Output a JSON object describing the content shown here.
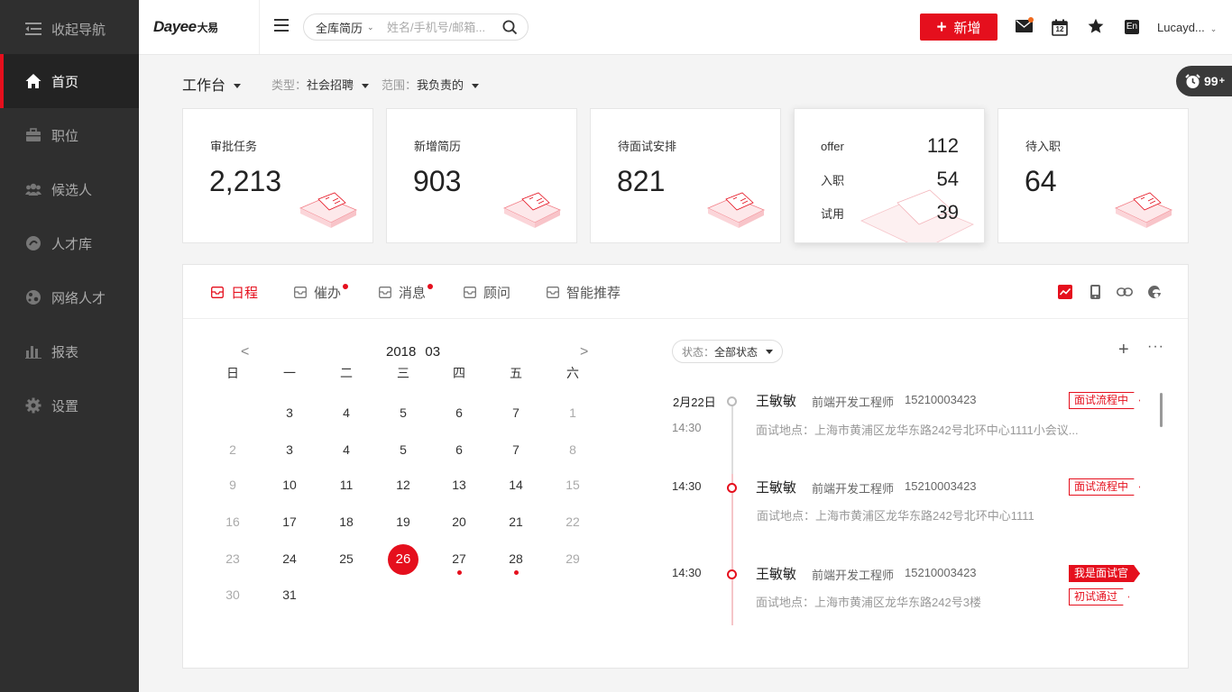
{
  "sidebar": {
    "collapse": "收起导航",
    "items": [
      {
        "label": "首页",
        "icon": "home-icon",
        "active": true
      },
      {
        "label": "职位",
        "icon": "briefcase-icon"
      },
      {
        "label": "候选人",
        "icon": "people-icon"
      },
      {
        "label": "人才库",
        "icon": "talent-pool-icon"
      },
      {
        "label": "网络人才",
        "icon": "network-icon"
      },
      {
        "label": "报表",
        "icon": "bar-chart-icon"
      },
      {
        "label": "设置",
        "icon": "gear-icon"
      }
    ]
  },
  "header": {
    "logo": "Dayee",
    "logo_cn": "大易",
    "search_scope": "全库简历",
    "search_placeholder": "姓名/手机号/邮箱...",
    "add_label": "新增",
    "calendar_day": "12",
    "lang": "En",
    "user": "Lucayd..."
  },
  "float_badge": {
    "count": "99",
    "suffix": "+"
  },
  "workbench": {
    "title": "工作台",
    "type_label": "类型：",
    "type_value": "社会招聘",
    "range_label": "范围：",
    "range_value": "我负责的"
  },
  "cards": [
    {
      "label": "审批任务",
      "value": "2,213"
    },
    {
      "label": "新增简历",
      "value": "903"
    },
    {
      "label": "待面试安排",
      "value": "821"
    },
    {
      "label": "待入职",
      "value": "64"
    }
  ],
  "multi_card": {
    "rows": [
      {
        "label": "offer",
        "value": "112"
      },
      {
        "label": "入职",
        "value": "54"
      },
      {
        "label": "试用",
        "value": "39"
      }
    ]
  },
  "tabs": [
    {
      "label": "日程",
      "active": true,
      "dot": false
    },
    {
      "label": "催办",
      "dot": true
    },
    {
      "label": "消息",
      "dot": true
    },
    {
      "label": "顾问",
      "dot": false
    },
    {
      "label": "智能推荐",
      "dot": false
    }
  ],
  "calendar": {
    "year": "2018",
    "month": "03",
    "prev": "<",
    "next": ">",
    "weekdays": [
      "日",
      "一",
      "二",
      "三",
      "四",
      "五",
      "六"
    ],
    "rows": [
      [
        null,
        "3",
        "4",
        "5",
        "6",
        "7",
        "1"
      ],
      [
        "2",
        "3",
        "4",
        "5",
        "6",
        "7",
        "8"
      ],
      [
        "9",
        "10",
        "11",
        "12",
        "13",
        "14",
        "15"
      ],
      [
        "16",
        "17",
        "18",
        "19",
        "20",
        "21",
        "22"
      ],
      [
        "23",
        "24",
        "25",
        "26",
        "27",
        "28",
        "29"
      ],
      [
        "30",
        "31",
        null,
        null,
        null,
        null,
        null
      ]
    ],
    "today": "26",
    "event_days": [
      "27",
      "28"
    ]
  },
  "schedule": {
    "status_label": "状态：",
    "status_value": "全部状态",
    "events": [
      {
        "date": "2月22日",
        "time": "14:30",
        "name": "王敏敏",
        "position": "前端开发工程师",
        "phone": "15210003423",
        "address": "面试地点：上海市黄浦区龙华东路242号北环中心1111小会议...",
        "tags": [
          {
            "text": "面试流程中",
            "solid": false
          }
        ]
      },
      {
        "date": "",
        "time": "14:30",
        "name": "王敏敏",
        "position": "前端开发工程师",
        "phone": "15210003423",
        "address": "面试地点：上海市黄浦区龙华东路242号北环中心1111",
        "tags": [
          {
            "text": "面试流程中",
            "solid": false
          }
        ]
      },
      {
        "date": "",
        "time": "14:30",
        "name": "王敏敏",
        "position": "前端开发工程师",
        "phone": "15210003423",
        "address": "面试地点：上海市黄浦区龙华东路242号3楼",
        "tags": [
          {
            "text": "我是面试官",
            "solid": true
          },
          {
            "text": "初试通过",
            "solid": false
          }
        ]
      }
    ]
  },
  "colors": {
    "accent": "#e50f1d",
    "sidebar_bg": "#2f2f2f"
  }
}
